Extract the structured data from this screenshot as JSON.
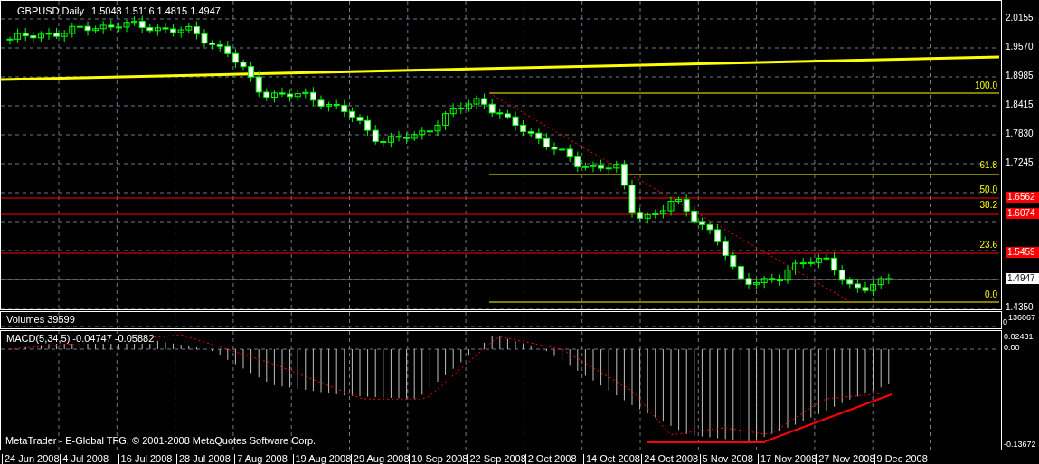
{
  "chart_header": {
    "symbol": "GBPUSD,Daily",
    "ohlc": "1.5043 1.5116 1.4815 1.4947"
  },
  "price_axis": [
    "2.0155",
    "1.9570",
    "1.8985",
    "1.8415",
    "1.7830",
    "1.7245",
    "1.4350"
  ],
  "fibonacci_levels": [
    "100.0",
    "61.8",
    "50.0",
    "38.2",
    "23.6",
    "0.0"
  ],
  "price_markers": [
    {
      "label": "1.6562",
      "kind": "level"
    },
    {
      "label": "1.6074",
      "kind": "level"
    },
    {
      "label": "1.5459",
      "kind": "level"
    },
    {
      "label": "1.4947",
      "kind": "current"
    }
  ],
  "volumes_panel": {
    "title": "Volumes 39599",
    "scale_max": "136067",
    "scale_min": "0"
  },
  "macd_panel": {
    "title": "MACD(5,34,5) -0.04747 -0.05882",
    "scale": [
      "0.02431",
      "0.00",
      "-0.13672"
    ]
  },
  "copyright": "MetaTrader - E-Global TFG, © 2001-2008 MetaQuotes Software Corp.",
  "date_axis": [
    "24 Jun 2008",
    "4 Jul 2008",
    "16 Jul 2008",
    "28 Jul 2008",
    "7 Aug 2008",
    "19 Aug 2008",
    "29 Aug 2008",
    "10 Sep 2008",
    "22 Sep 2008",
    "2 Oct 2008",
    "14 Oct 2008",
    "24 Oct 2008",
    "5 Nov 2008",
    "17 Nov 2008",
    "27 Nov 2008",
    "9 Dec 2008"
  ]
}
